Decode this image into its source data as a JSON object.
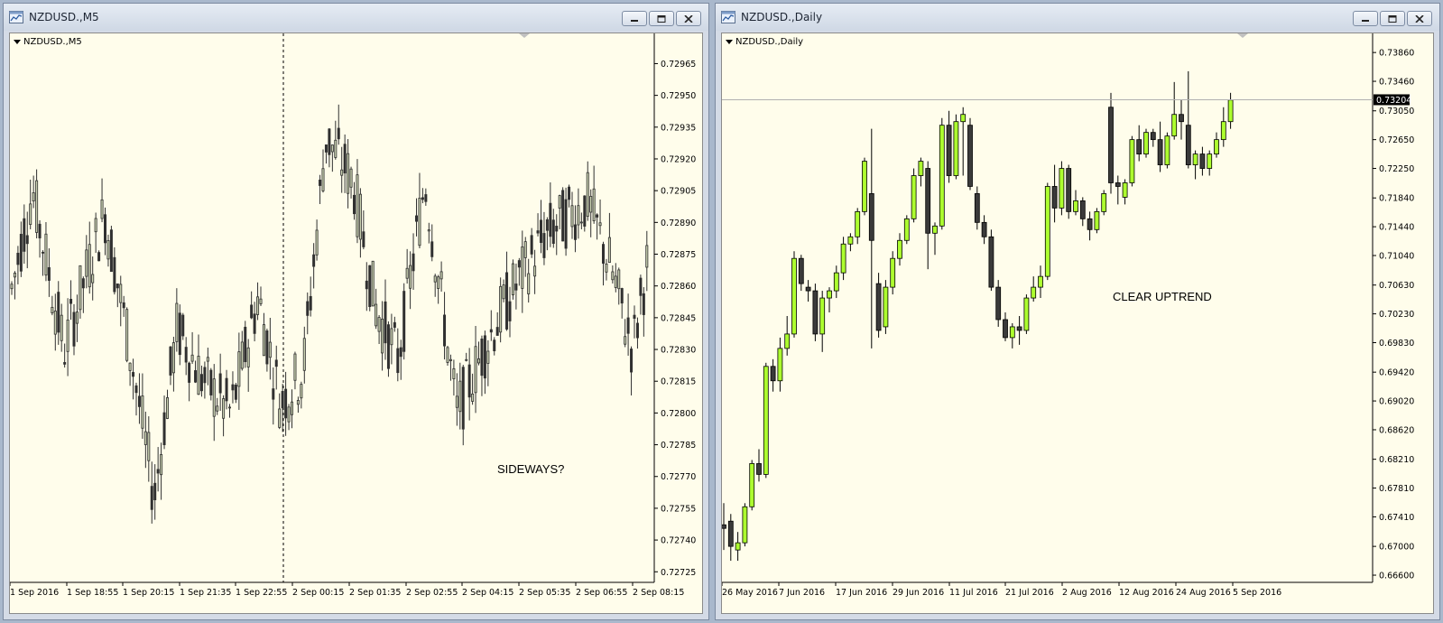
{
  "windows": {
    "left": {
      "title": "NZDUSD.,M5",
      "symbol_label": "NZDUSD.,M5",
      "annotation": "SIDEWAYS?",
      "chart_data": {
        "type": "candlestick",
        "timeframe": "M5",
        "y_ticks": [
          "0.72965",
          "0.72950",
          "0.72935",
          "0.72920",
          "0.72905",
          "0.72890",
          "0.72875",
          "0.72860",
          "0.72845",
          "0.72830",
          "0.72815",
          "0.72800",
          "0.72785",
          "0.72770",
          "0.72755",
          "0.72740",
          "0.72725"
        ],
        "ylim": [
          0.7272,
          0.72975
        ],
        "x_labels": [
          "1 Sep 2016",
          "1 Sep 18:55",
          "1 Sep 20:15",
          "1 Sep 21:35",
          "1 Sep 22:55",
          "2 Sep 00:15",
          "2 Sep 01:35",
          "2 Sep 02:55",
          "2 Sep 04:15",
          "2 Sep 05:35",
          "2 Sep 06:55",
          "2 Sep 08:15"
        ],
        "period_separator_label_index": 5,
        "colors": {
          "up": "#c8d0b0",
          "down": "#303030",
          "outline": "#303030"
        }
      }
    },
    "right": {
      "title": "NZDUSD.,Daily",
      "symbol_label": "NZDUSD.,Daily",
      "annotation": "CLEAR UPTREND",
      "chart_data": {
        "type": "candlestick",
        "timeframe": "Daily",
        "y_ticks": [
          "0.73860",
          "0.73460",
          "0.73050",
          "0.72650",
          "0.72250",
          "0.71840",
          "0.71440",
          "0.71040",
          "0.70630",
          "0.70230",
          "0.69830",
          "0.69420",
          "0.69020",
          "0.68620",
          "0.68210",
          "0.67810",
          "0.67410",
          "0.67000",
          "0.66600"
        ],
        "ylim": [
          0.665,
          0.74
        ],
        "current_price": "0.73204",
        "x_labels": [
          "26 May 2016",
          "7 Jun 2016",
          "17 Jun 2016",
          "29 Jun 2016",
          "11 Jul 2016",
          "21 Jul 2016",
          "2 Aug 2016",
          "12 Aug 2016",
          "24 Aug 2016",
          "5 Sep 2016"
        ],
        "colors": {
          "up": "#adff2f",
          "down": "#3a3a3a",
          "outline": "#000000",
          "bid_line": "#b0b0b0",
          "price_tag": "#000000"
        },
        "candles": [
          [
            0.673,
            0.676,
            0.6695,
            0.6725
          ],
          [
            0.6735,
            0.6745,
            0.668,
            0.67
          ],
          [
            0.6695,
            0.672,
            0.668,
            0.6705
          ],
          [
            0.6705,
            0.676,
            0.67,
            0.6755
          ],
          [
            0.6755,
            0.682,
            0.675,
            0.6815
          ],
          [
            0.6815,
            0.6835,
            0.679,
            0.68
          ],
          [
            0.68,
            0.6955,
            0.6795,
            0.695
          ],
          [
            0.695,
            0.696,
            0.6915,
            0.693
          ],
          [
            0.693,
            0.699,
            0.6915,
            0.6975
          ],
          [
            0.6975,
            0.702,
            0.6965,
            0.6995
          ],
          [
            0.6995,
            0.711,
            0.699,
            0.71
          ],
          [
            0.71,
            0.7105,
            0.7055,
            0.7065
          ],
          [
            0.706,
            0.707,
            0.704,
            0.7055
          ],
          [
            0.7055,
            0.7065,
            0.6985,
            0.6995
          ],
          [
            0.6995,
            0.7055,
            0.697,
            0.7045
          ],
          [
            0.7045,
            0.706,
            0.7025,
            0.7055
          ],
          [
            0.7055,
            0.709,
            0.7045,
            0.708
          ],
          [
            0.708,
            0.713,
            0.707,
            0.712
          ],
          [
            0.712,
            0.7135,
            0.711,
            0.713
          ],
          [
            0.713,
            0.717,
            0.712,
            0.7165
          ],
          [
            0.7165,
            0.724,
            0.716,
            0.7235
          ],
          [
            0.719,
            0.728,
            0.6975,
            0.7125
          ],
          [
            0.7065,
            0.708,
            0.699,
            0.7
          ],
          [
            0.7005,
            0.707,
            0.6995,
            0.706
          ],
          [
            0.706,
            0.711,
            0.705,
            0.71
          ],
          [
            0.71,
            0.7135,
            0.709,
            0.7125
          ],
          [
            0.7125,
            0.716,
            0.712,
            0.7155
          ],
          [
            0.7155,
            0.7225,
            0.715,
            0.7215
          ],
          [
            0.7215,
            0.724,
            0.72,
            0.7235
          ],
          [
            0.7225,
            0.7235,
            0.7085,
            0.7135
          ],
          [
            0.7135,
            0.715,
            0.7105,
            0.7145
          ],
          [
            0.7145,
            0.7295,
            0.714,
            0.7285
          ],
          [
            0.7285,
            0.7305,
            0.7205,
            0.7215
          ],
          [
            0.7215,
            0.73,
            0.721,
            0.729
          ],
          [
            0.729,
            0.731,
            0.7215,
            0.73
          ],
          [
            0.7285,
            0.7295,
            0.7195,
            0.72
          ],
          [
            0.719,
            0.72,
            0.714,
            0.715
          ],
          [
            0.715,
            0.716,
            0.712,
            0.713
          ],
          [
            0.713,
            0.714,
            0.7055,
            0.706
          ],
          [
            0.706,
            0.707,
            0.7005,
            0.7015
          ],
          [
            0.7015,
            0.7025,
            0.6985,
            0.699
          ],
          [
            0.699,
            0.701,
            0.6975,
            0.7005
          ],
          [
            0.7005,
            0.702,
            0.698,
            0.7
          ],
          [
            0.7,
            0.705,
            0.6995,
            0.7045
          ],
          [
            0.7045,
            0.7075,
            0.704,
            0.706
          ],
          [
            0.706,
            0.709,
            0.7045,
            0.7075
          ],
          [
            0.7075,
            0.7205,
            0.707,
            0.72
          ],
          [
            0.72,
            0.723,
            0.715,
            0.717
          ],
          [
            0.717,
            0.7235,
            0.716,
            0.7225
          ],
          [
            0.7225,
            0.723,
            0.7155,
            0.7165
          ],
          [
            0.7165,
            0.7195,
            0.716,
            0.718
          ],
          [
            0.718,
            0.7185,
            0.7145,
            0.7155
          ],
          [
            0.7155,
            0.7165,
            0.7125,
            0.714
          ],
          [
            0.714,
            0.717,
            0.7135,
            0.7165
          ],
          [
            0.7165,
            0.7195,
            0.716,
            0.719
          ],
          [
            0.731,
            0.733,
            0.719,
            0.7205
          ],
          [
            0.7205,
            0.7215,
            0.7175,
            0.72
          ],
          [
            0.7185,
            0.721,
            0.7175,
            0.7205
          ],
          [
            0.7205,
            0.727,
            0.72,
            0.7265
          ],
          [
            0.7265,
            0.7285,
            0.7235,
            0.7245
          ],
          [
            0.7245,
            0.728,
            0.724,
            0.7275
          ],
          [
            0.7275,
            0.728,
            0.7255,
            0.7265
          ],
          [
            0.7265,
            0.729,
            0.722,
            0.723
          ],
          [
            0.723,
            0.7275,
            0.7225,
            0.727
          ],
          [
            0.727,
            0.7345,
            0.7265,
            0.73
          ],
          [
            0.73,
            0.732,
            0.7265,
            0.729
          ],
          [
            0.7285,
            0.736,
            0.7225,
            0.723
          ],
          [
            0.723,
            0.725,
            0.721,
            0.7245
          ],
          [
            0.7245,
            0.7255,
            0.7215,
            0.7225
          ],
          [
            0.7225,
            0.725,
            0.7215,
            0.7245
          ],
          [
            0.7245,
            0.7275,
            0.724,
            0.7265
          ],
          [
            0.7265,
            0.731,
            0.7255,
            0.729
          ],
          [
            0.729,
            0.733,
            0.728,
            0.732
          ]
        ]
      }
    }
  }
}
